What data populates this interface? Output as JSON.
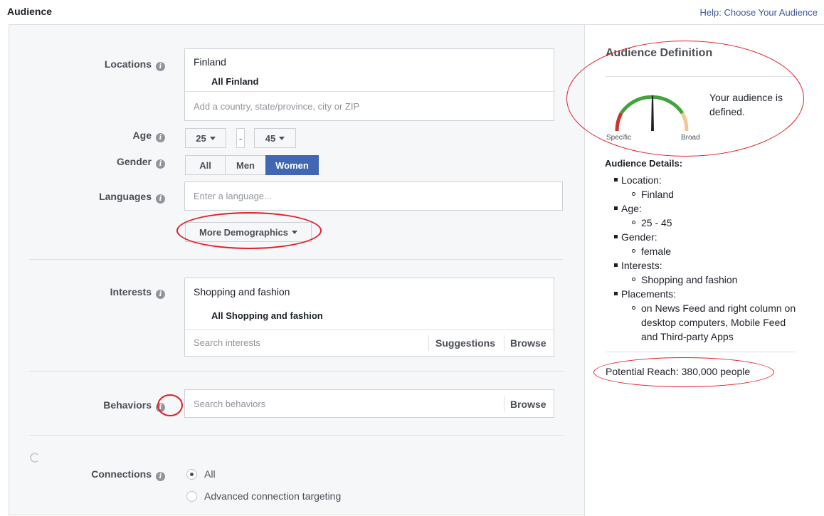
{
  "header": {
    "title": "Audience",
    "help_link": "Help: Choose Your Audience"
  },
  "form": {
    "locations": {
      "label": "Locations",
      "country": "Finland",
      "selection": "All Finland",
      "placeholder": "Add a country, state/province, city or ZIP"
    },
    "age": {
      "label": "Age",
      "min": "25",
      "separator": "-",
      "max": "45"
    },
    "gender": {
      "label": "Gender",
      "options": [
        "All",
        "Men",
        "Women"
      ],
      "selected": "Women"
    },
    "languages": {
      "label": "Languages",
      "placeholder": "Enter a language..."
    },
    "more_demographics": "More Demographics",
    "interests": {
      "label": "Interests",
      "category": "Shopping and fashion",
      "selection": "All Shopping and fashion",
      "placeholder": "Search interests",
      "suggestions": "Suggestions",
      "browse": "Browse"
    },
    "behaviors": {
      "label": "Behaviors",
      "placeholder": "Search behaviors",
      "browse": "Browse"
    },
    "connections": {
      "label": "Connections",
      "options": [
        "All",
        "Advanced connection targeting"
      ],
      "selected": "All"
    }
  },
  "audience_definition": {
    "title": "Audience Definition",
    "status": "Your audience is defined.",
    "gauge_left": "Specific",
    "gauge_right": "Broad",
    "details_title": "Audience Details:",
    "details": [
      {
        "label": "Location:",
        "values": [
          "Finland"
        ]
      },
      {
        "label": "Age:",
        "values": [
          "25 - 45"
        ]
      },
      {
        "label": "Gender:",
        "values": [
          "female"
        ]
      },
      {
        "label": "Interests:",
        "values": [
          "Shopping and fashion"
        ]
      },
      {
        "label": "Placements:",
        "values": [
          "on News Feed and right column on desktop computers, Mobile Feed and Third-party Apps"
        ]
      }
    ],
    "potential_reach": "Potential Reach: 380,000 people"
  },
  "colors": {
    "accent": "#4267b2",
    "annotation": "#e41e26",
    "gauge_red": "#c8352b",
    "gauge_green": "#42a33c",
    "gauge_orange": "#f6c58f"
  }
}
